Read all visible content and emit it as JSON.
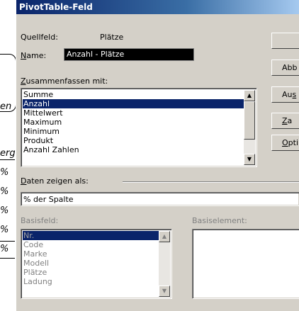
{
  "background": {
    "callout_text": "en",
    "fragments": [
      "erg",
      "%",
      "%",
      "%",
      "%",
      "%"
    ]
  },
  "dialog": {
    "title": "PivotTable-Feld",
    "source_field_label": "Quellfeld:",
    "source_field_value": "Plätze",
    "name_label": "Name:",
    "name_value": "Anzahl - Plätze",
    "summarize_label": "Zusammenfassen mit:",
    "summarize_items": [
      "Summe",
      "Anzahl",
      "Mittelwert",
      "Maximum",
      "Minimum",
      "Produkt",
      "Anzahl Zahlen"
    ],
    "summarize_selected": 1,
    "show_data_label": "Daten zeigen als:",
    "show_data_value": "% der Spalte",
    "base_field_label": "Basisfeld:",
    "base_field_items": [
      "Nr.",
      "Code",
      "Marke",
      "Modell",
      "Plätze",
      "Ladung"
    ],
    "base_item_label": "Basiselement:",
    "buttons": [
      "",
      "Abb",
      "Aus",
      "Za",
      "Opti"
    ]
  },
  "colors": {
    "title_bar": "#0a246a",
    "selection": "#0a246a",
    "dialog_face": "#d4d0c8"
  }
}
